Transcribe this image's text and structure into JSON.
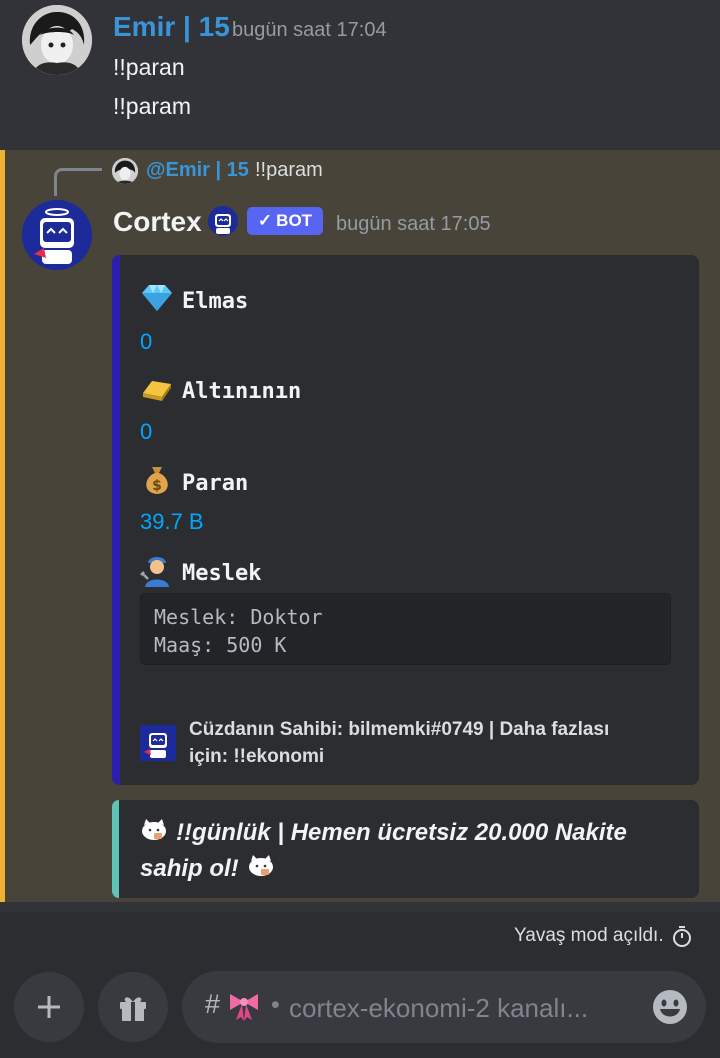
{
  "message1": {
    "author": "Emir | 15",
    "author_color": "#3a95d8",
    "timestamp": "bugün saat 17:04",
    "lines": [
      "!!paran",
      "!!param"
    ]
  },
  "message2": {
    "reply": {
      "mention": "@Emir | 15",
      "text": "!!param"
    },
    "author": "Cortex",
    "bot_badge": "BOT",
    "timestamp": "bugün saat 17:05",
    "embed": {
      "fields": [
        {
          "icon": "gem-icon",
          "name": "Elmas",
          "value": "0"
        },
        {
          "icon": "gold-bar-icon",
          "name": "Altınının",
          "value": "0"
        },
        {
          "icon": "money-bag-icon",
          "name": "Paran",
          "value": "39.7 B"
        },
        {
          "icon": "mechanic-icon",
          "name": "Meslek"
        }
      ],
      "job_code": [
        "Meslek: Doktor",
        "Maaş: 500 K"
      ],
      "footer": [
        "Cüzdanın Sahibi: bilmemki#0749 | Daha fazlası",
        "için: !!ekonomi"
      ]
    },
    "embed2": {
      "lines": [
        "!!günlük | Hemen ücretsiz 20.000 Nakite",
        "sahip ol!"
      ]
    }
  },
  "slowmode": "Yavaş mod açıldı.",
  "composer": {
    "placeholder": "cortex-ekonomi-2 kanalı..."
  }
}
